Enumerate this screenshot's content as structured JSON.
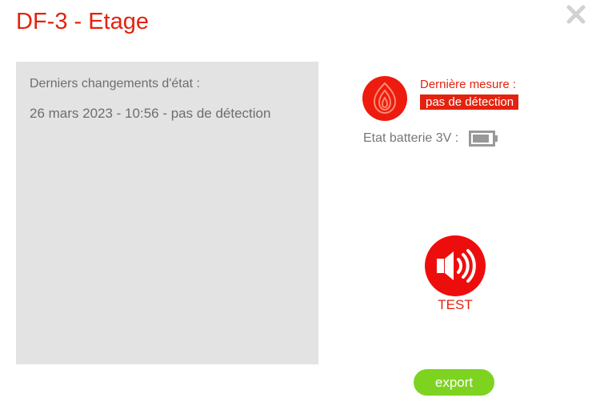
{
  "dialog": {
    "title": "DF-3 - Etage"
  },
  "history": {
    "title": "Derniers changements d'état :",
    "entries": [
      "26 mars 2023 - 10:56 - pas de détection"
    ]
  },
  "measure": {
    "label": "Dernière mesure :",
    "value": "pas de détection",
    "icon": "flame-icon"
  },
  "battery": {
    "label": "Etat batterie 3V :",
    "icon": "battery-icon"
  },
  "actions": {
    "test_label": "TEST",
    "test_icon": "speaker-icon",
    "export_label": "export",
    "close_icon": "close-icon"
  },
  "colors": {
    "accent_red": "#e3230f",
    "export_green": "#7ed321",
    "panel_gray": "#e3e3e3"
  }
}
